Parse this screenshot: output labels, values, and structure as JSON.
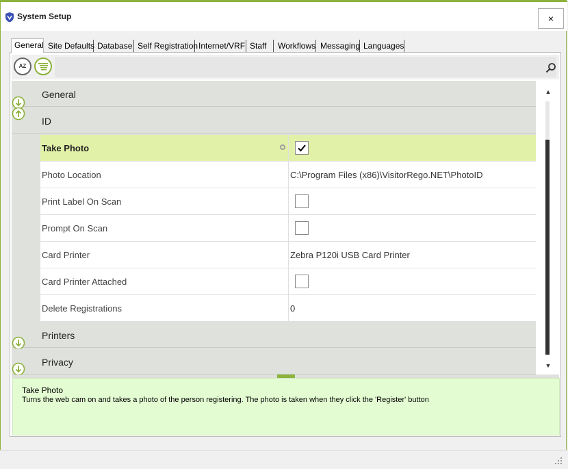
{
  "window": {
    "title": "System Setup",
    "close_glyph": "×",
    "icon": "app-shield-icon"
  },
  "tabs": [
    {
      "label": "General",
      "active": true
    },
    {
      "label": "Site Defaults"
    },
    {
      "label": "Database"
    },
    {
      "label": "Self Registration"
    },
    {
      "label": "Internet/VRF"
    },
    {
      "label": "Staff"
    },
    {
      "label": "Workflows"
    },
    {
      "label": "Messaging"
    },
    {
      "label": "Languages"
    }
  ],
  "toolbar": {
    "sort_alpha_label": "AZ",
    "search_value": "",
    "search_placeholder": ""
  },
  "grid": {
    "categories": [
      {
        "label": "General",
        "state": "collapsed"
      },
      {
        "label": "ID",
        "state": "expanded"
      },
      {
        "label": "Printers",
        "state": "collapsed"
      },
      {
        "label": "Privacy",
        "state": "collapsed"
      }
    ],
    "properties": [
      {
        "name": "Take Photo",
        "type": "checkbox",
        "checked": true,
        "selected": true
      },
      {
        "name": "Photo Location",
        "type": "text",
        "value": "C:\\Program Files (x86)\\VisitorRego.NET\\PhotoID"
      },
      {
        "name": "Print Label On Scan",
        "type": "checkbox",
        "checked": false
      },
      {
        "name": "Prompt On Scan",
        "type": "checkbox",
        "checked": false
      },
      {
        "name": "Card Printer",
        "type": "text",
        "value": "Zebra P120i USB Card Printer"
      },
      {
        "name": "Card Printer Attached",
        "type": "checkbox",
        "checked": false
      },
      {
        "name": "Delete Registrations",
        "type": "text",
        "value": "0"
      }
    ]
  },
  "description": {
    "title": "Take Photo",
    "text": "Turns the web cam on and takes a photo of the person registering. The photo is taken when they click the 'Register' button"
  },
  "scrollbar": {
    "up_glyph": "▲",
    "down_glyph": "▼"
  },
  "colors": {
    "accent": "#8cb23c",
    "selected_row": "#e2f1a8",
    "description_bg": "#e3fcd2",
    "category_bg": "#dfe1dc"
  }
}
